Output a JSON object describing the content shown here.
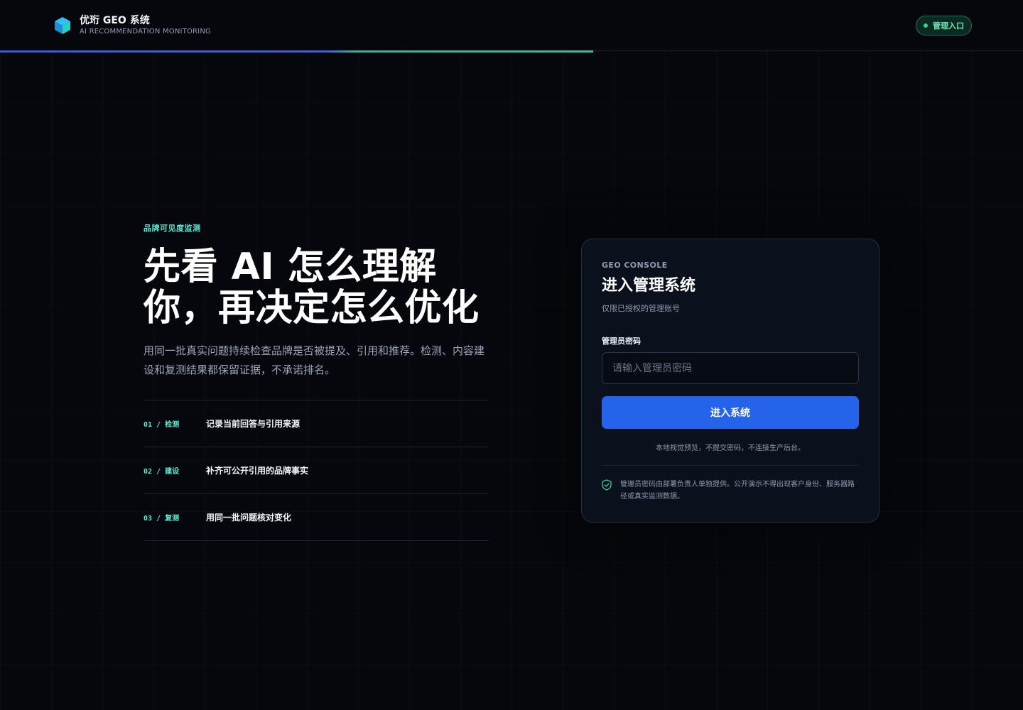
{
  "header": {
    "brand_name": "优珩 GEO 系统",
    "brand_subtitle": "AI RECOMMENDATION MONITORING",
    "admin_label": "管理入口",
    "progress": 0.58
  },
  "hero": {
    "eyebrow": "品牌可见度监测",
    "headline_line1": "先看 AI 怎么理解",
    "headline_line2": "你，再决定怎么优化",
    "intro": "用同一批真实问题持续检查品牌是否被提及、引用和推荐。检测、内容建设和复测结果都保留证据，不承诺排名。",
    "steps": [
      {
        "tag": "01 / 检测",
        "text": "记录当前回答与引用来源"
      },
      {
        "tag": "02 / 建设",
        "text": "补齐可公开引用的品牌事实"
      },
      {
        "tag": "03 / 复测",
        "text": "用同一批问题核对变化"
      }
    ]
  },
  "login": {
    "eyebrow": "GEO CONSOLE",
    "title": "进入管理系统",
    "subtitle": "仅限已授权的管理账号",
    "password_label": "管理员密码",
    "password_placeholder": "请输入管理员密码",
    "password_value": "",
    "submit_label": "进入系统",
    "note": "本地视觉预览，不提交密码，不连接生产后台。",
    "security_note": "管理员密码由部署负责人单独提供。公开演示不得出现客户身份、服务器路径或真实监测数据。"
  },
  "colors": {
    "accent": "#2563eb",
    "teal": "#5eead4",
    "status_green": "#34d399",
    "background": "#05070c"
  }
}
